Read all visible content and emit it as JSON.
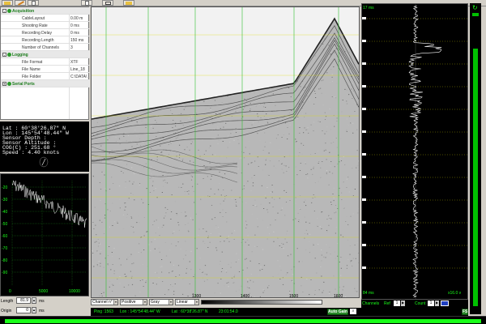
{
  "toolbar": {
    "icons": [
      "folder-icon",
      "pencil-icon",
      "document-icon",
      "document-icon",
      "window-icon",
      "folder-icon"
    ]
  },
  "properties": {
    "rows": [
      {
        "type": "cat",
        "label": "Acquisition",
        "expander": "-"
      },
      {
        "type": "item",
        "label": "CableLayout",
        "value": "0.00 m"
      },
      {
        "type": "item",
        "label": "Shooting Rate",
        "value": "0 ms"
      },
      {
        "type": "item",
        "label": "Recording Delay",
        "value": "0 ms"
      },
      {
        "type": "item",
        "label": "Recording Length",
        "value": "150 ms"
      },
      {
        "type": "item",
        "label": "Number of Channels",
        "value": "3"
      },
      {
        "type": "cat",
        "label": "Logging",
        "expander": "-"
      },
      {
        "type": "item",
        "label": "File Format",
        "value": "XTF"
      },
      {
        "type": "item",
        "label": "File Name",
        "value": "Line_18"
      },
      {
        "type": "item",
        "label": "File Folder",
        "value": "C:\\DATA\\"
      },
      {
        "type": "cat",
        "label": "Serial Ports",
        "expander": "+"
      }
    ]
  },
  "nav": {
    "lat": "Lat     : 60°38'26.87\" N",
    "lon": "Lon     : 145°54'48.44\" W",
    "depth": "Sensor Depth    :",
    "altitude": "Sensor Altitude :",
    "cog": "COG(C) : 251.68 °",
    "speed": "Speed : 4.40 knots"
  },
  "spectrum": {
    "y_ticks": [
      "-20",
      "-30",
      "-40",
      "-50",
      "-60",
      "-70",
      "-80",
      "-90"
    ],
    "x_ticks": [
      "0",
      "5000",
      "10000"
    ]
  },
  "controls": {
    "length_label": "Length",
    "length_value": "81.9",
    "length_unit": "ms",
    "origin_label": "Origin",
    "origin_value": "0",
    "origin_unit": "ms"
  },
  "sonar": {
    "x_ticks": [
      "1300",
      "1400",
      "1500",
      "1600"
    ],
    "channel": "Channel n° 01",
    "polarity": "Positive",
    "palette": "Gray",
    "scale": "Linear"
  },
  "trace": {
    "top_label": "17 ms",
    "bottom_label": "84 ms",
    "channels_label": "Channels",
    "ref_label": "Ref",
    "ref_value": "1",
    "count_label": "Count",
    "count_value": "1",
    "corner_label": "x16.0 v"
  },
  "status": {
    "ping": "Ping :1563",
    "lon": "Lon  : 145°54'48.44\" W",
    "lat": "Lat  : 60°38'26.87\" N",
    "time": "23:01:54.0",
    "auto_gain": "Auto Gain",
    "fs": "FS"
  },
  "colors": {
    "accent_green": "#1aff1a",
    "category_green": "#1a7a1a",
    "scroll_green": "#00c000"
  }
}
